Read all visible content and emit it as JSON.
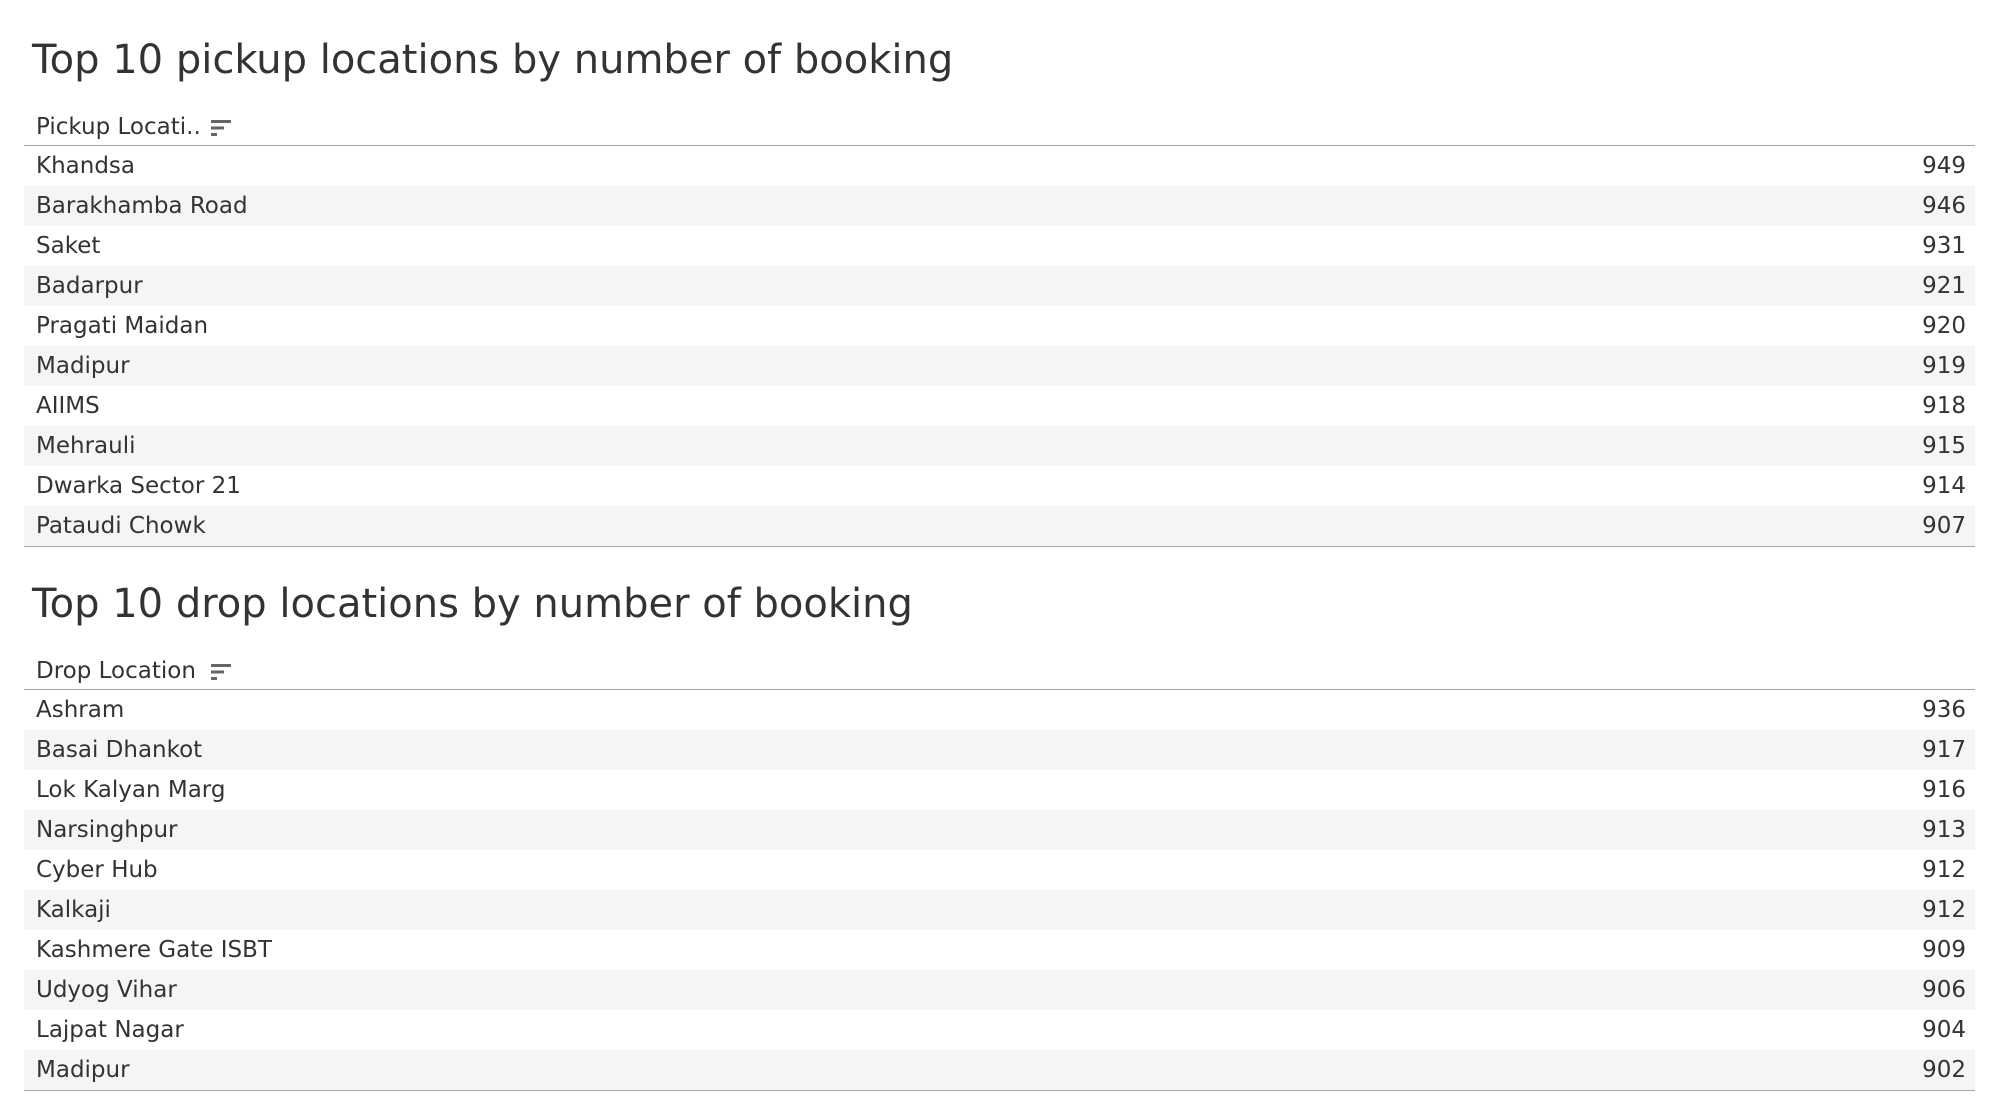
{
  "chart_data": [
    {
      "type": "table",
      "title": "Top 10 pickup locations by number of booking",
      "column_header": "Pickup Locati..",
      "categories": [
        "Khandsa",
        "Barakhamba Road",
        "Saket",
        "Badarpur",
        "Pragati Maidan",
        "Madipur",
        "AIIMS",
        "Mehrauli",
        "Dwarka Sector 21",
        "Pataudi Chowk"
      ],
      "values": [
        949,
        946,
        931,
        921,
        920,
        919,
        918,
        915,
        914,
        907
      ],
      "sort_icon": "sort-descending-icon"
    },
    {
      "type": "table",
      "title": "Top 10 drop locations by number of booking",
      "column_header": "Drop Location",
      "categories": [
        "Ashram",
        "Basai Dhankot",
        "Lok Kalyan Marg",
        "Narsinghpur",
        "Cyber Hub",
        "Kalkaji",
        "Kashmere Gate ISBT",
        "Udyog Vihar",
        "Lajpat Nagar",
        "Madipur"
      ],
      "values": [
        936,
        917,
        916,
        913,
        912,
        912,
        909,
        906,
        904,
        902
      ],
      "sort_icon": "sort-descending-icon"
    }
  ],
  "colors": {
    "text": "#333333",
    "stripe": "#f5f5f5",
    "rule": "#a3a3a3",
    "icon": "#666666"
  }
}
